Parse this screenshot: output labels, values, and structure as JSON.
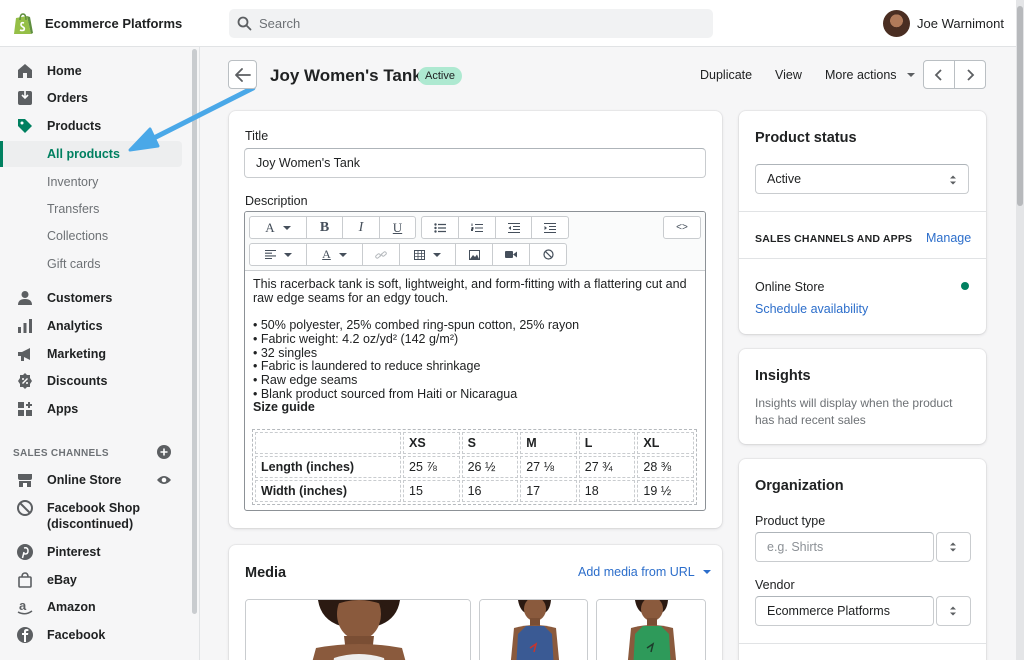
{
  "topbar": {
    "store_name": "Ecommerce Platforms",
    "search_placeholder": "Search",
    "user_name": "Joe Warnimont"
  },
  "sidebar": {
    "items": [
      {
        "label": "Home",
        "icon": "home-icon"
      },
      {
        "label": "Orders",
        "icon": "orders-icon"
      },
      {
        "label": "Products",
        "icon": "tag-icon"
      }
    ],
    "product_sub_items": [
      "All products",
      "Inventory",
      "Transfers",
      "Collections",
      "Gift cards"
    ],
    "items2": [
      {
        "label": "Customers",
        "icon": "person-icon"
      },
      {
        "label": "Analytics",
        "icon": "bar-chart-icon"
      },
      {
        "label": "Marketing",
        "icon": "megaphone-icon"
      },
      {
        "label": "Discounts",
        "icon": "discount-icon"
      },
      {
        "label": "Apps",
        "icon": "apps-icon"
      }
    ],
    "channels_heading": "SALES CHANNELS",
    "channels": [
      {
        "label": "Online Store",
        "icon": "store-icon"
      },
      {
        "label": "Facebook Shop\n(discontinued)",
        "icon": "blocked-icon"
      },
      {
        "label": "Pinterest",
        "icon": "pinterest-icon"
      },
      {
        "label": "eBay",
        "icon": "bag-icon"
      },
      {
        "label": "Amazon",
        "icon": "amazon-icon"
      },
      {
        "label": "Facebook",
        "icon": "facebook-icon"
      }
    ]
  },
  "page": {
    "title": "Joy Women's Tank",
    "status_badge": "Active",
    "actions": {
      "duplicate": "Duplicate",
      "view": "View",
      "more": "More actions"
    }
  },
  "product": {
    "title_label": "Title",
    "title_value": "Joy Women's Tank",
    "description_label": "Description",
    "description_intro": "This racerback tank is soft, lightweight, and form-fitting with a flattering cut and raw edge seams for an edgy touch.",
    "bullets": [
      "• 50% polyester, 25% combed ring-spun cotton, 25% rayon",
      "• Fabric weight: 4.2 oz/yd² (142 g/m²)",
      "• 32 singles",
      "• Fabric is laundered to reduce shrinkage",
      "• Raw edge seams",
      "• Blank product sourced from Haiti or Nicaragua"
    ],
    "size_guide_label": "Size guide",
    "size_table": {
      "header": [
        "",
        "XS",
        "S",
        "M",
        "L",
        "XL"
      ],
      "rows": [
        [
          "Length (inches)",
          "25 ⅞",
          "26 ½",
          "27 ⅛",
          "27 ¾",
          "28 ⅜"
        ],
        [
          "Width (inches)",
          "15",
          "16",
          "17",
          "18",
          "19 ½"
        ]
      ]
    }
  },
  "media": {
    "title": "Media",
    "add_from_url": "Add media from URL"
  },
  "status_card": {
    "title": "Product status",
    "selected": "Active",
    "channels_heading": "SALES CHANNELS AND APPS",
    "manage": "Manage",
    "channel": "Online Store",
    "schedule": "Schedule availability"
  },
  "insights": {
    "title": "Insights",
    "text": "Insights will display when the product has had recent sales"
  },
  "organization": {
    "title": "Organization",
    "type_label": "Product type",
    "type_placeholder": "e.g. Shirts",
    "vendor_label": "Vendor",
    "vendor_value": "Ecommerce Platforms"
  },
  "colors": {
    "accent": "#008060",
    "link": "#2c6ecb",
    "annotation_arrow": "#4aa8e8"
  }
}
